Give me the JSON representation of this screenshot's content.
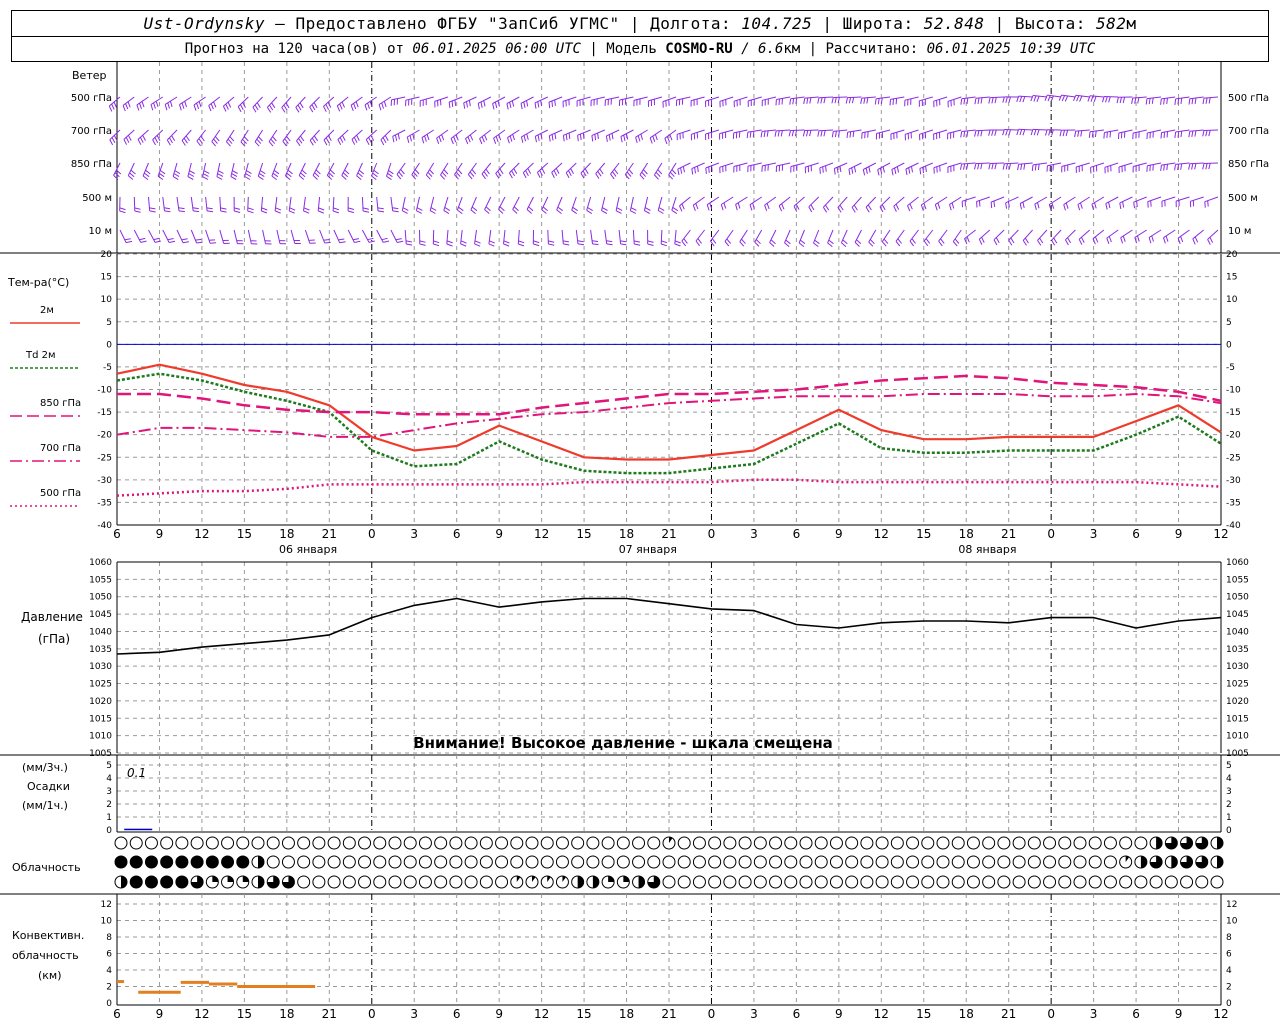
{
  "header": {
    "station": "Ust-Ordynsky",
    "dash": " — ",
    "provider": "Предоставлено ФГБУ \"ЗапСиб УГМС\"",
    "lon_label": "Долгота:",
    "lon": "104.725",
    "lat_label": "Широта:",
    "lat": "52.848",
    "alt_label": "Высота:",
    "alt": "582",
    "alt_unit": "м",
    "forecast_prefix": "Прогноз на 120 часа(ов) от",
    "forecast_time": "06.01.2025 06:00 UTC",
    "model_label": "Модель",
    "model": "COSMO-RU",
    "model_res": "/ 6.6",
    "model_res_unit": "км",
    "calc_label": "Рассчитано:",
    "calc_time": "06.01.2025 10:39 UTC"
  },
  "colors": {
    "wind": "#8a2be2",
    "t2m": "#ee3b2b",
    "td2m": "#1e7a1e",
    "t850": "#e0147a",
    "t700": "#e0147a",
    "t500": "#e0147a",
    "pressure": "#000000",
    "precip": "#0000cc",
    "convective": "#e08020",
    "zero_line": "#0000cc",
    "grid": "#9a9a9a"
  },
  "wind_panel": {
    "title": "Ветер",
    "levels": [
      "500 гПа",
      "700 гПа",
      "850 гПа",
      "500 м",
      "10  м"
    ]
  },
  "temp_panel": {
    "title": "Тем-ра(°С)",
    "legend": [
      {
        "label": "2м",
        "style": "solid"
      },
      {
        "label": "Td  2м",
        "style": "dotted"
      },
      {
        "label": "850 гПа",
        "style": "dash"
      },
      {
        "label": "700 гПа",
        "style": "dashdot"
      },
      {
        "label": "500 гПа",
        "style": "dot"
      }
    ],
    "y_ticks": [
      20,
      15,
      10,
      5,
      0,
      -5,
      -10,
      -15,
      -20,
      -25,
      -30,
      -35,
      -40
    ],
    "x_ticks": [
      "6",
      "9",
      "12",
      "15",
      "18",
      "21",
      "0",
      "3",
      "6",
      "9",
      "12",
      "15",
      "18",
      "21",
      "0",
      "3",
      "6",
      "9",
      "12",
      "15",
      "18",
      "21",
      "0",
      "3",
      "6",
      "9",
      "12"
    ],
    "dates": [
      "06 января",
      "07 января",
      "08 января"
    ]
  },
  "pressure_panel": {
    "title": "Давление",
    "unit": "(гПа)",
    "y_ticks": [
      1060,
      1055,
      1050,
      1045,
      1040,
      1035,
      1030,
      1025,
      1020,
      1015,
      1010,
      1005
    ],
    "warning": "Внимание! Высокое давление - шкала смещена"
  },
  "precip_panel": {
    "label_3h": "(мм/3ч.)",
    "title": "Осадки",
    "label_1h": "(мм/1ч.)",
    "y_ticks": [
      5,
      4,
      3,
      2,
      1,
      0
    ],
    "annotation": "0.1"
  },
  "cloud_panel": {
    "title": "Облачность"
  },
  "conv_panel": {
    "title1": "Конвективн.",
    "title2": "облачность",
    "unit": "(км)",
    "y_ticks": [
      12,
      10,
      8,
      6,
      4,
      2,
      0
    ]
  },
  "chart_data": [
    {
      "type": "line",
      "title": "Тем-ра(°С)",
      "x_hours": [
        0,
        3,
        6,
        9,
        12,
        15,
        18,
        21,
        24,
        27,
        30,
        33,
        36,
        39,
        42,
        45,
        48,
        51,
        54,
        57,
        60,
        63,
        66,
        69,
        72,
        75,
        78
      ],
      "ylim": [
        -40,
        20
      ],
      "series": [
        {
          "name": "2м",
          "values": [
            -6.5,
            -4.5,
            -6.5,
            -9,
            -10.5,
            -13.5,
            -20.5,
            -23.5,
            -22.5,
            -18,
            -21.5,
            -25,
            -25.5,
            -25.5,
            -24.5,
            -23.5,
            -19,
            -14.5,
            -19,
            -21,
            -21,
            -20.5,
            -20.5,
            -20.5,
            -17,
            -13.5,
            -19.5
          ]
        },
        {
          "name": "Td  2м",
          "values": [
            -8,
            -6.5,
            -8,
            -10.5,
            -12.5,
            -15,
            -23.5,
            -27,
            -26.5,
            -21.5,
            -25.5,
            -28,
            -28.5,
            -28.5,
            -27.5,
            -26.5,
            -22,
            -17.5,
            -23,
            -24,
            -24,
            -23.5,
            -23.5,
            -23.5,
            -20,
            -16,
            -22
          ]
        },
        {
          "name": "850 гПа",
          "values": [
            -11,
            -11,
            -12,
            -13.5,
            -14.5,
            -15,
            -15,
            -15.5,
            -15.5,
            -15.5,
            -14,
            -13,
            -12,
            -11,
            -11,
            -10.5,
            -10,
            -9,
            -8,
            -7.5,
            -7,
            -7.5,
            -8.5,
            -9,
            -9.5,
            -10.5,
            -12.5
          ]
        },
        {
          "name": "700 гПа",
          "values": [
            -20,
            -18.5,
            -18.5,
            -19,
            -19.5,
            -20.5,
            -20.5,
            -19,
            -17.5,
            -16.5,
            -15.5,
            -15,
            -14,
            -13,
            -12.5,
            -12,
            -11.5,
            -11.5,
            -11.5,
            -11,
            -11,
            -11,
            -11.5,
            -11.5,
            -11,
            -11.5,
            -13
          ]
        },
        {
          "name": "500 гПа",
          "values": [
            -33.5,
            -33,
            -32.5,
            -32.5,
            -32,
            -31,
            -31,
            -31,
            -31,
            -31,
            -31,
            -30.5,
            -30.5,
            -30.5,
            -30.5,
            -30,
            -30,
            -30.5,
            -30.5,
            -30.5,
            -30.5,
            -30.5,
            -30.5,
            -30.5,
            -30.5,
            -31,
            -31.5
          ]
        }
      ]
    },
    {
      "type": "line",
      "title": "Давление",
      "x_hours": [
        0,
        3,
        6,
        9,
        12,
        15,
        18,
        21,
        24,
        27,
        30,
        33,
        36,
        39,
        42,
        45,
        48,
        51,
        54,
        57,
        60,
        63,
        66,
        69,
        72,
        75,
        78
      ],
      "ylim": [
        1005,
        1060
      ],
      "series": [
        {
          "name": "Давление",
          "values": [
            1033.5,
            1034,
            1035.5,
            1036.5,
            1037.5,
            1039,
            1044,
            1047.5,
            1049.5,
            1047,
            1048.5,
            1049.5,
            1049.5,
            1048,
            1046.5,
            1046,
            1042,
            1041,
            1042.5,
            1043,
            1043,
            1042.5,
            1044,
            1044,
            1041,
            1043,
            1044
          ]
        }
      ]
    },
    {
      "type": "bar",
      "title": "Осадки",
      "x_hours": [
        1.5
      ],
      "ylim": [
        0,
        5
      ],
      "values": [
        0.1
      ]
    }
  ]
}
